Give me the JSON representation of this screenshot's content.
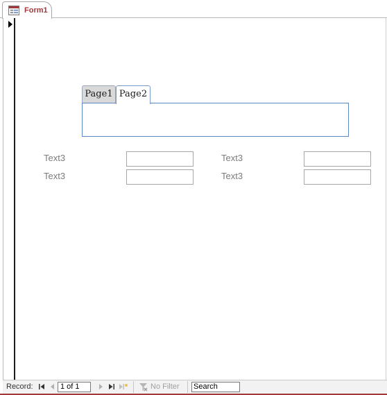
{
  "document_tab": {
    "title": "Form1",
    "icon": "form-icon"
  },
  "tab_control": {
    "pages": [
      {
        "label": "Page1"
      },
      {
        "label": "Page2"
      }
    ],
    "active": "Page2"
  },
  "fields": [
    {
      "label": "Text3",
      "value": ""
    },
    {
      "label": "Text3",
      "value": ""
    },
    {
      "label": "Text3",
      "value": ""
    },
    {
      "label": "Text3",
      "value": ""
    }
  ],
  "navigation": {
    "record_label": "Record:",
    "current": "1 of 1",
    "filter_label": "No Filter",
    "filter_icon": "no-filter-icon",
    "search_placeholder": "Search"
  },
  "colors": {
    "tab_title": "#a4373a",
    "tab_border": "#5b87c6"
  }
}
